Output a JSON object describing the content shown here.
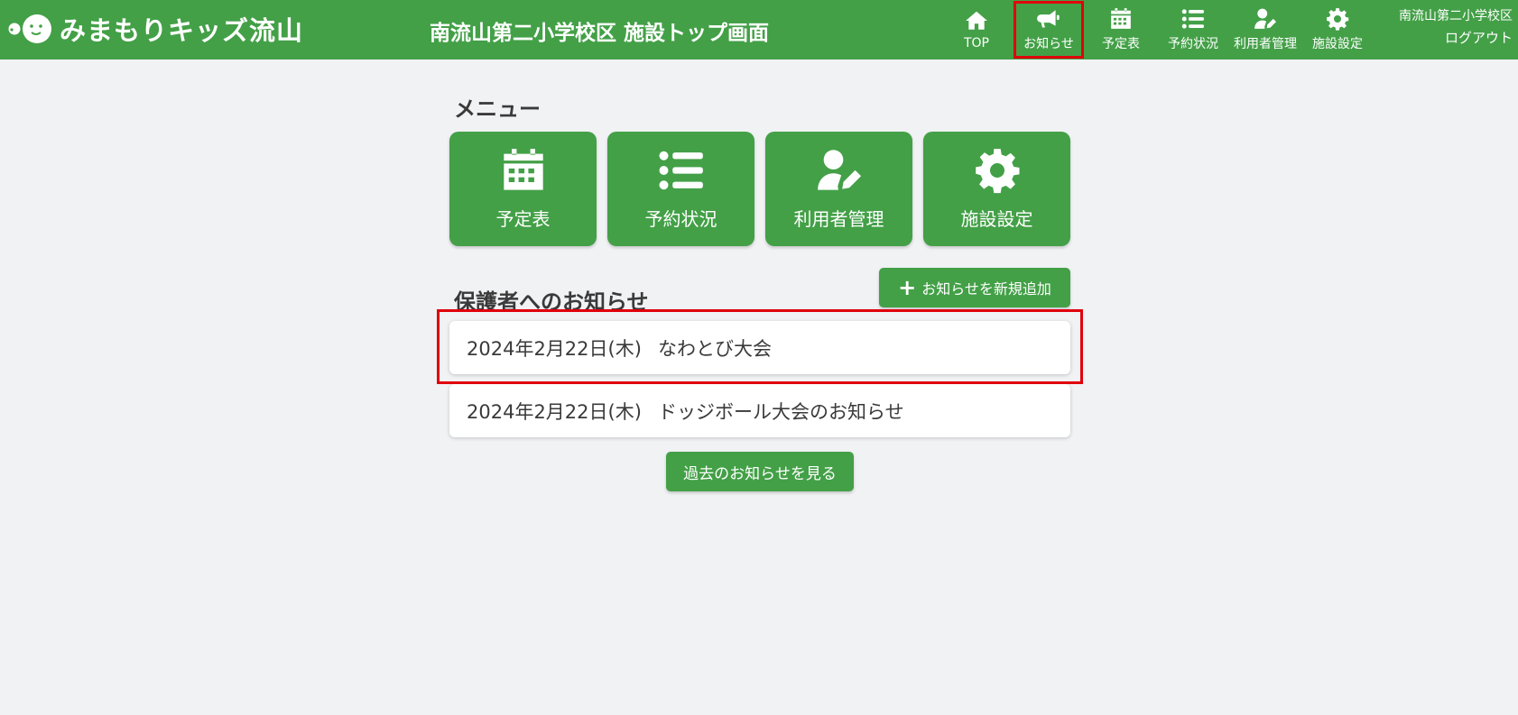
{
  "header": {
    "logo_text": "みまもりキッズ流山",
    "logo_icon": "kids-mascot-icon",
    "page_title": "南流山第二小学校区 施設トップ画面",
    "nav": [
      {
        "label": "TOP",
        "icon": "home-icon"
      },
      {
        "label": "お知らせ",
        "icon": "megaphone-icon"
      },
      {
        "label": "予定表",
        "icon": "calendar-icon"
      },
      {
        "label": "予約状況",
        "icon": "list-icon"
      },
      {
        "label": "利用者管理",
        "icon": "user-edit-icon"
      },
      {
        "label": "施設設定",
        "icon": "gear-icon"
      }
    ],
    "user_name": "南流山第二小学校区",
    "logout": "ログアウト"
  },
  "menu": {
    "title": "メニュー",
    "items": [
      {
        "label": "予定表",
        "icon": "calendar-icon"
      },
      {
        "label": "予約状況",
        "icon": "list-icon"
      },
      {
        "label": "利用者管理",
        "icon": "user-edit-icon"
      },
      {
        "label": "施設設定",
        "icon": "gear-icon"
      }
    ]
  },
  "notices": {
    "title": "保護者へのお知らせ",
    "add_button": "お知らせを新規追加",
    "items": [
      {
        "date": "2024年2月22日(木)",
        "title": "なわとび大会"
      },
      {
        "date": "2024年2月22日(木)",
        "title": "ドッジボール大会のお知らせ"
      }
    ],
    "past_button": "過去のお知らせを見る"
  },
  "colors": {
    "brand_green": "#43a047",
    "highlight_red": "#e0000b",
    "background": "#f1f2f4"
  }
}
